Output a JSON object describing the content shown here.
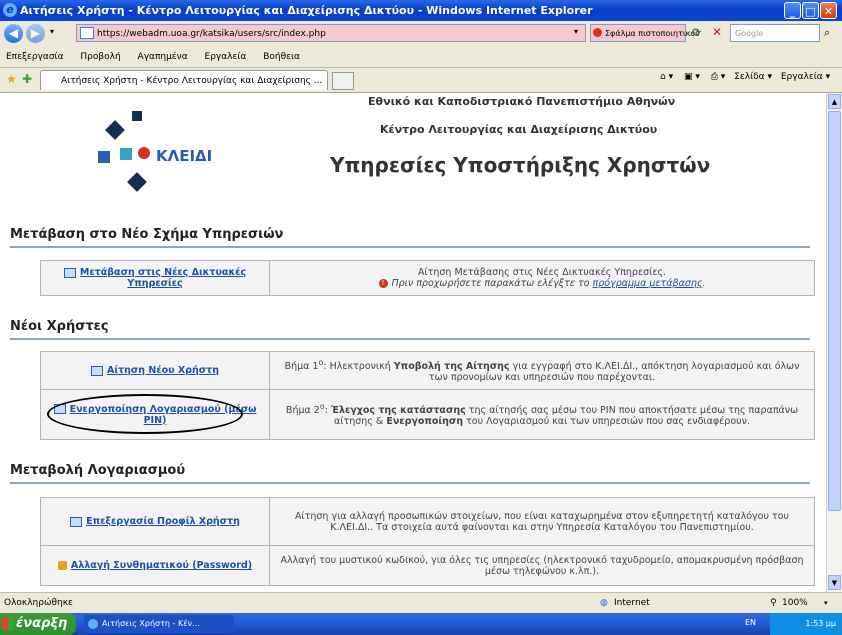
{
  "window": {
    "title": "Αιτήσεις Χρήστη - Κέντρο Λειτουργίας και Διαχείρισης Δικτύου - Windows Internet Explorer",
    "url": "https://webadm.uoa.gr/katsika/users/src/index.php",
    "cert_error": "Σφάλμα πιστοποιητικού",
    "search_placeholder": "Google"
  },
  "menu": [
    "Επεξεργασία",
    "Προβολή",
    "Αγαπημένα",
    "Εργαλεία",
    "Βοήθεια"
  ],
  "tab": {
    "label": "Αιτήσεις Χρήστη - Κέντρο Λειτουργίας και Διαχείρισης ..."
  },
  "commandbar": {
    "page": "Σελίδα",
    "tools": "Εργαλεία"
  },
  "page": {
    "logo_text": "ΚΛΕΙΔΙ",
    "university": "Εθνικό και Καποδιστριακό Πανεπιστήμιο Αθηνών",
    "center": "Κέντρο Λειτουργίας και Διαχείρισης Δικτύου",
    "services_title": "Υπηρεσίες Υποστήριξης Χρηστών",
    "sec1": {
      "title": "Μετάβαση στο Νέο Σχήμα Υπηρεσιών",
      "link": "Μετάβαση στις Νέες Δικτυακές Υπηρεσίες",
      "desc": "Αίτηση Μετάβασης στις Νέες Δικτυακές Υπηρεσίες.",
      "note": "Πριν προχωρήσετε παρακάτω ελέγξτε το",
      "note_link": "πρόγραμμα μετάβασης",
      "note_end": "."
    },
    "sec2": {
      "title": "Νέοι Χρήστες",
      "row1_link": "Αίτηση Νέου Χρήστη",
      "row1_desc_a": "Βήμα 1",
      "row1_sup": "ο",
      "row1_desc_b": ": Ηλεκτρονική ",
      "row1_bold": "Υποβολή της Αίτησης",
      "row1_desc_c": " για εγγραφή στο Κ.ΛΕΙ.ΔΙ., απόκτηση λογαριασμού και όλων των προνομίων και υπηρεσιών που παρέχονται.",
      "row2_link": "Ενεργοποίηση Λογαριασμού (μέσω PIN)",
      "row2_desc_a": "Βήμα 2",
      "row2_sup": "ο",
      "row2_desc_b": ": ",
      "row2_bold1": "Έλεγχος της κατάστασης",
      "row2_desc_c": " της αίτησής σας μέσω του PIN που αποκτήσατε μέσω της παραπάνω αίτησης & ",
      "row2_bold2": "Ενεργοποίηση",
      "row2_desc_d": " του Λογαριασμού και των υπηρεσιών που σας ενδιαφέρουν."
    },
    "sec3": {
      "title": "Μεταβολή Λογαριασμού",
      "row1_link": "Επεξεργασία Προφίλ Χρήστη",
      "row1_desc": "Αίτηση για αλλαγή προσωπικών στοιχείων, που είναι καταχωρημένα στον εξυπηρετητή καταλόγου του Κ.ΛΕΙ.ΔΙ.. Τα στοιχεία αυτά φαίνονται και στην Υπηρεσία Καταλόγου του Πανεπιστημίου.",
      "row2_link": "Αλλαγή Συνθηματικού (Password)",
      "row2_desc": "Αλλαγή του μυστικού κωδικού, για όλες τις υπηρεσίες (ηλεκτρονικό ταχυδρομείο, απομακρυσμένη πρόσβαση μέσω τηλεφώνου κ.λπ.)."
    }
  },
  "status": {
    "left": "Ολοκληρώθηκε",
    "zone": "Internet",
    "zoom": "100%"
  },
  "taskbar": {
    "start": "έναρξη",
    "item": "Αιτήσεις Χρήστη - Κέν...",
    "lang": "EN",
    "clock": "1:53 μμ"
  },
  "colors": {
    "title_blue": "#0a3cc8",
    "link": "#1a53a8",
    "url_error_bg": "#f5c9cf"
  }
}
